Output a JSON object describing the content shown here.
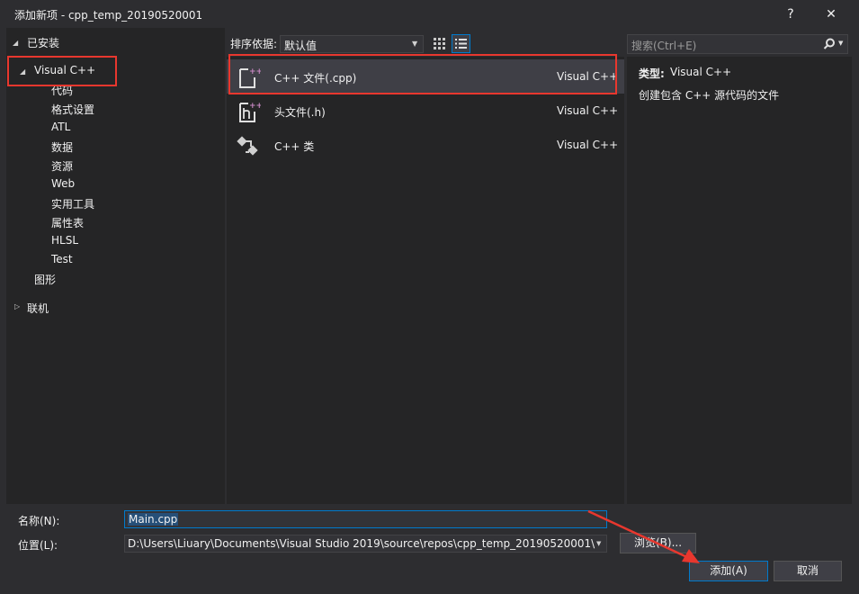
{
  "window": {
    "title": "添加新项 - cpp_temp_20190520001",
    "help_label": "?",
    "close_label": "✕"
  },
  "tree": {
    "installed_label": "已安装",
    "visual_cpp_label": "Visual C++",
    "children": [
      "代码",
      "格式设置",
      "ATL",
      "数据",
      "资源",
      "Web",
      "实用工具",
      "属性表",
      "HLSL",
      "Test"
    ],
    "graphics_label": "图形",
    "online_label": "联机"
  },
  "toolbar": {
    "sort_label": "排序依据:",
    "sort_value": "默认值",
    "search_placeholder": "搜索(Ctrl+E)"
  },
  "templates": [
    {
      "name": "C++ 文件(.cpp)",
      "lang": "Visual C++",
      "icon": "cpp-file-icon",
      "selected": true
    },
    {
      "name": "头文件(.h)",
      "lang": "Visual C++",
      "icon": "header-file-icon",
      "selected": false
    },
    {
      "name": "C++ 类",
      "lang": "Visual C++",
      "icon": "cpp-class-icon",
      "selected": false
    }
  ],
  "details": {
    "type_label": "类型:",
    "type_value": "Visual C++",
    "description": "创建包含 C++ 源代码的文件"
  },
  "form": {
    "name_label": "名称(N):",
    "name_value": "Main.cpp",
    "location_label": "位置(L):",
    "location_value": "D:\\Users\\Liuary\\Documents\\Visual Studio 2019\\source\\repos\\cpp_temp_20190520001\\",
    "browse_label": "浏览(B)...",
    "add_label": "添加(A)",
    "cancel_label": "取消"
  },
  "colors": {
    "background": "#2d2d30",
    "pane": "#252526",
    "selection": "#3f3f46",
    "annotation_red": "#e8372e",
    "accent_blue": "#007acc"
  }
}
